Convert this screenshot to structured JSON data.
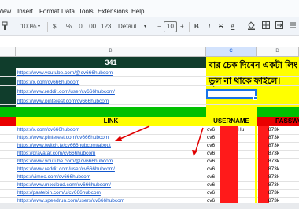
{
  "menu": {
    "items": [
      "View",
      "Insert",
      "Format",
      "Data",
      "Tools",
      "Extensions",
      "Help"
    ]
  },
  "toolbar": {
    "zoom": "100%",
    "currency": "$",
    "percent": "%",
    "dec_decrease": ".0",
    "dec_increase": ".00",
    "number_format": "123",
    "font": "Defaul...",
    "font_size": "10",
    "minus": "−",
    "plus": "+"
  },
  "columns": {
    "b": "B",
    "c": "C",
    "d": "D"
  },
  "top": {
    "count": "341",
    "links": [
      "https://www.youtube.com/@cv666hubcom",
      "https://x.com/cv666hubcom",
      "https://www.reddit.com/user/cv666hubcom/",
      "https://www.pinterest.com/cv666hubcom"
    ],
    "bengali_line1": "বার চেক দিবেন একটা লিং",
    "bengali_line2": "ভুল না থাকে ফাইলে।"
  },
  "table": {
    "headers": {
      "link": "LINK",
      "username": "USERNAME",
      "password": "PASSWO"
    },
    "rows": [
      {
        "link": "https://x.com/cv666hubcom",
        "user": "cv6",
        "pw": "873k"
      },
      {
        "link": "https://www.pinterest.com/cv666hubcom",
        "user": "cv6",
        "pw": "873k"
      },
      {
        "link": "https://www.twitch.tv/cv666hubcom/about",
        "user": "cv6",
        "pw": "873k"
      },
      {
        "link": "https://gravatar.com/cv666hubcom",
        "user": "cv6",
        "pw": "873k"
      },
      {
        "link": "https://www.youtube.com/@cv666hubcom",
        "user": "cv6",
        "pw": "873k"
      },
      {
        "link": "https://www.reddit.com/user/cv666hubcom/",
        "user": "cv6",
        "pw": "873k"
      },
      {
        "link": "https://vimeo.com/cv666hubcom",
        "user": "cv6",
        "pw": "873k"
      },
      {
        "link": "https://www.mixcloud.com/cv666hubcom/",
        "user": "cv6",
        "pw": "873k"
      },
      {
        "link": "https://pastebin.com/u/cv666hubcom",
        "user": "cv6",
        "pw": "873k"
      },
      {
        "link": "https://www.speedrun.com/users/cv666hubcom",
        "user": "cv6",
        "pw": "873k"
      }
    ],
    "partial_user": "Hu"
  },
  "colors": {
    "dark_green": "#103d2c",
    "yellow": "#ffff00",
    "red": "#ea0000",
    "link_blue": "#1155cc",
    "selection_blue": "#1a73e8"
  },
  "icons": [
    "paint-format-icon",
    "bold-icon",
    "italic-icon",
    "strikethrough-icon",
    "text-color-icon",
    "undo-icon",
    "chevron-down-icon",
    "red-arrow-annotation"
  ]
}
